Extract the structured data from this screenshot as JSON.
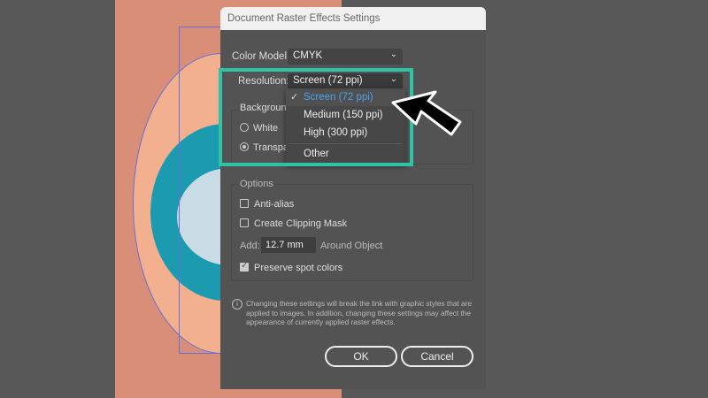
{
  "dialog": {
    "title": "Document Raster Effects Settings",
    "color_model": {
      "label": "Color Model:",
      "value": "CMYK"
    },
    "resolution": {
      "label": "Resolution:",
      "value": "Screen (72 ppi)",
      "options": [
        "Screen (72 ppi)",
        "Medium (150 ppi)",
        "High (300 ppi)",
        "Other"
      ],
      "selected": "Screen (72 ppi)"
    },
    "background": {
      "label": "Backgrounc",
      "options": [
        {
          "label": "White",
          "checked": false
        },
        {
          "label": "Transpa",
          "checked": true
        }
      ]
    },
    "options": {
      "label": "Options",
      "anti_alias": {
        "label": "Anti-alias",
        "checked": false
      },
      "clipping_mask": {
        "label": "Create Clipping Mask",
        "checked": false
      },
      "add_label": "Add:",
      "add_value": "12.7 mm",
      "add_suffix": "Around Object",
      "preserve_spot": {
        "label": "Preserve spot colors",
        "checked": true
      }
    },
    "info": "Changing these settings will break the link with graphic styles that are applied to images. In addition, changing these settings may affect the appearance of currently applied raster effects.",
    "ok_label": "OK",
    "cancel_label": "Cancel"
  },
  "colors": {
    "highlight": "#2fc4a4",
    "selected_item": "#4aa3f0",
    "canvas": "#d98e78"
  }
}
